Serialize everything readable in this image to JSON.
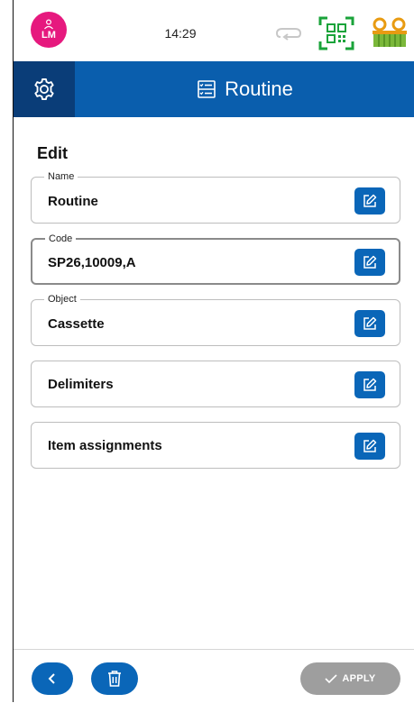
{
  "status_bar": {
    "user_initials": "LM",
    "time": "14:29"
  },
  "header": {
    "title": "Routine",
    "settings_icon": "gear-icon",
    "title_icon": "routine-list-icon"
  },
  "form": {
    "heading": "Edit",
    "fields": [
      {
        "label": "Name",
        "value": "Routine"
      },
      {
        "label": "Code",
        "value": "SP26,10009,A"
      },
      {
        "label": "Object",
        "value": "Cassette"
      },
      {
        "label": "",
        "value": "Delimiters"
      },
      {
        "label": "",
        "value": "Item assignments"
      }
    ]
  },
  "footer": {
    "apply_label": "APPLY"
  },
  "colors": {
    "header_blue": "#0a5ead",
    "header_dark": "#0a3d78",
    "button_blue": "#0a66b8",
    "avatar_pink": "#e6197e",
    "scanner_green": "#1aa33a",
    "disabled_gray": "#9e9e9e"
  }
}
